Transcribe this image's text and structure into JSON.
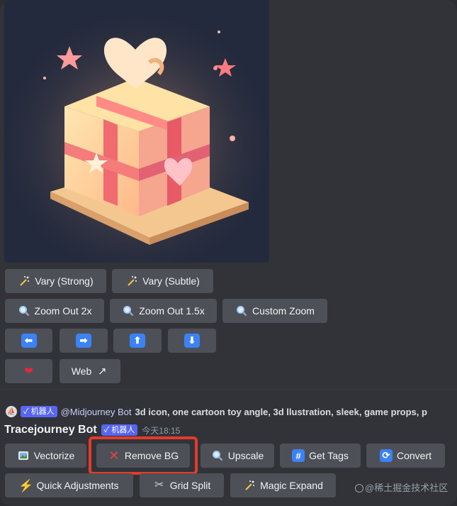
{
  "image": {
    "alt": "Generated image"
  },
  "buttons": {
    "vary_strong": {
      "label": "Vary (Strong)",
      "icon": "magic-wand-icon"
    },
    "vary_subtle": {
      "label": "Vary (Subtle)",
      "icon": "magic-wand-icon"
    },
    "zoom_out_2x": {
      "label": "Zoom Out 2x",
      "icon": "magnifier-icon"
    },
    "zoom_out_1_5x": {
      "label": "Zoom Out 1.5x",
      "icon": "magnifier-icon"
    },
    "custom_zoom": {
      "label": "Custom Zoom",
      "icon": "magnifier-icon"
    },
    "pan_left": {
      "glyph": "⬅",
      "icon": "arrow-left-icon"
    },
    "pan_right": {
      "glyph": "➡",
      "icon": "arrow-right-icon"
    },
    "pan_up": {
      "glyph": "⬆",
      "icon": "arrow-up-icon"
    },
    "pan_down": {
      "glyph": "⬇",
      "icon": "arrow-down-icon"
    },
    "favorite": {
      "glyph": "❤",
      "icon": "heart-icon"
    },
    "web": {
      "label": "Web",
      "glyph": "↗",
      "icon": "external-link-icon"
    }
  },
  "reply": {
    "badge": "机器人",
    "mention": "@Midjourney Bot",
    "prompt": "3d icon, one cartoon toy angle, 3d llustration, sleek, game props, p"
  },
  "message": {
    "bot_name": "Tracejourney Bot",
    "badge": "机器人",
    "timestamp": "今天18:15"
  },
  "actions": {
    "vectorize": {
      "label": "Vectorize",
      "icon": "picture-icon"
    },
    "remove_bg": {
      "label": "Remove BG",
      "glyph": "✕",
      "icon": "cross-icon"
    },
    "upscale": {
      "label": "Upscale",
      "icon": "magnifier-icon"
    },
    "get_tags": {
      "label": "Get Tags",
      "glyph": "#",
      "icon": "hash-icon"
    },
    "convert": {
      "label": "Convert",
      "glyph": "⟳",
      "icon": "refresh-icon"
    },
    "quick_adjustments": {
      "label": "Quick Adjustments",
      "glyph": "⚡",
      "icon": "lightning-icon"
    },
    "grid_split": {
      "label": "Grid Split",
      "glyph": "✂",
      "icon": "scissors-icon"
    },
    "magic_expand": {
      "label": "Magic Expand",
      "icon": "magic-wand-icon"
    }
  },
  "watermark": "@稀土掘金技术社区",
  "colors": {
    "accent_blue": "#3b82f6",
    "badge": "#5865f2",
    "highlight": "#e53b2a",
    "button": "#4e5058"
  }
}
